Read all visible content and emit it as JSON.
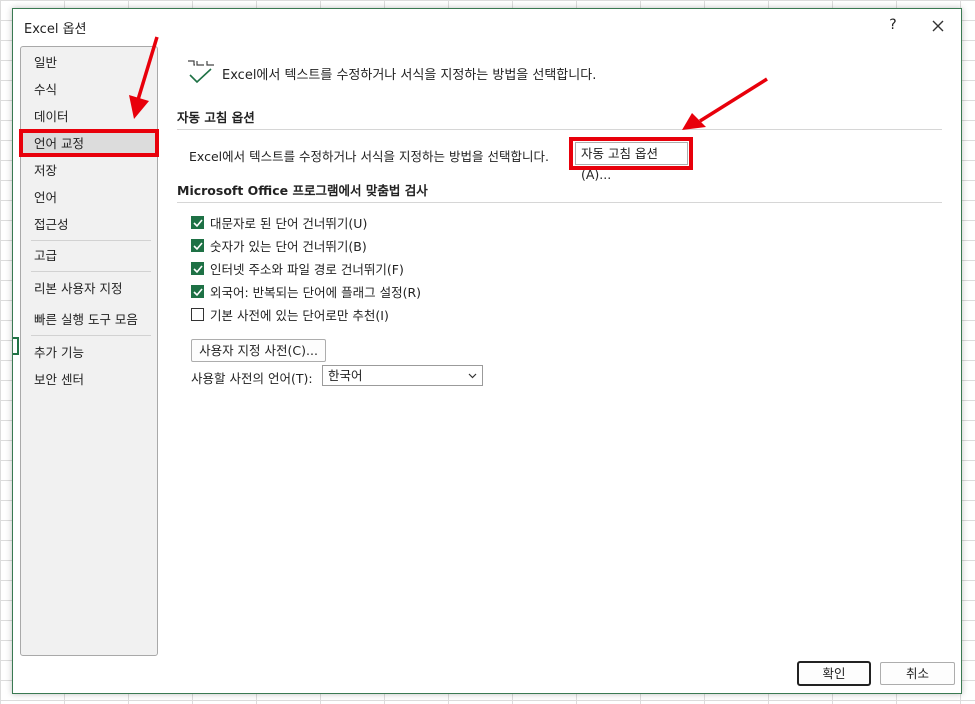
{
  "dialog": {
    "title": "Excel 옵션",
    "help_label": "?",
    "ok_label": "확인",
    "cancel_label": "취소"
  },
  "sidebar": {
    "items": [
      {
        "label": "일반"
      },
      {
        "label": "수식"
      },
      {
        "label": "데이터"
      },
      {
        "label": "언어 교정",
        "selected": true
      },
      {
        "label": "저장"
      },
      {
        "label": "언어"
      },
      {
        "label": "접근성"
      },
      {
        "label": "고급"
      },
      {
        "label": "리본 사용자 지정"
      },
      {
        "label": "빠른 실행 도구 모음"
      },
      {
        "label": "추가 기능"
      },
      {
        "label": "보안 센터"
      }
    ]
  },
  "main": {
    "header_description": "Excel에서 텍스트를 수정하거나 서식을 지정하는 방법을 선택합니다.",
    "autocorrect": {
      "section_title": "자동 고침 옵션",
      "description": "Excel에서 텍스트를 수정하거나 서식을 지정하는 방법을 선택합니다.",
      "button_label": "자동 고침 옵션(A)..."
    },
    "spelling": {
      "section_title": "Microsoft Office 프로그램에서 맞춤법 검사",
      "checkboxes": [
        {
          "label": "대문자로 된 단어 건너뛰기(U)",
          "checked": true
        },
        {
          "label": "숫자가 있는 단어 건너뛰기(B)",
          "checked": true
        },
        {
          "label": "인터넷 주소와 파일 경로 건너뛰기(F)",
          "checked": true
        },
        {
          "label": "외국어: 반복되는 단어에 플래그 설정(R)",
          "checked": true
        },
        {
          "label": "기본 사전에 있는 단어로만 추천(I)",
          "checked": false
        }
      ],
      "custom_dict_label": "사용자 지정 사전(C)...",
      "dict_language_label": "사용할 사전의 언어(T):",
      "dict_language_value": "한국어"
    }
  },
  "colors": {
    "accent_green": "#1e7145",
    "annotation_red": "#e8000b"
  },
  "icons": [
    "close-icon",
    "proofing-check-icon",
    "checkmark-icon",
    "chevron-down-icon"
  ]
}
